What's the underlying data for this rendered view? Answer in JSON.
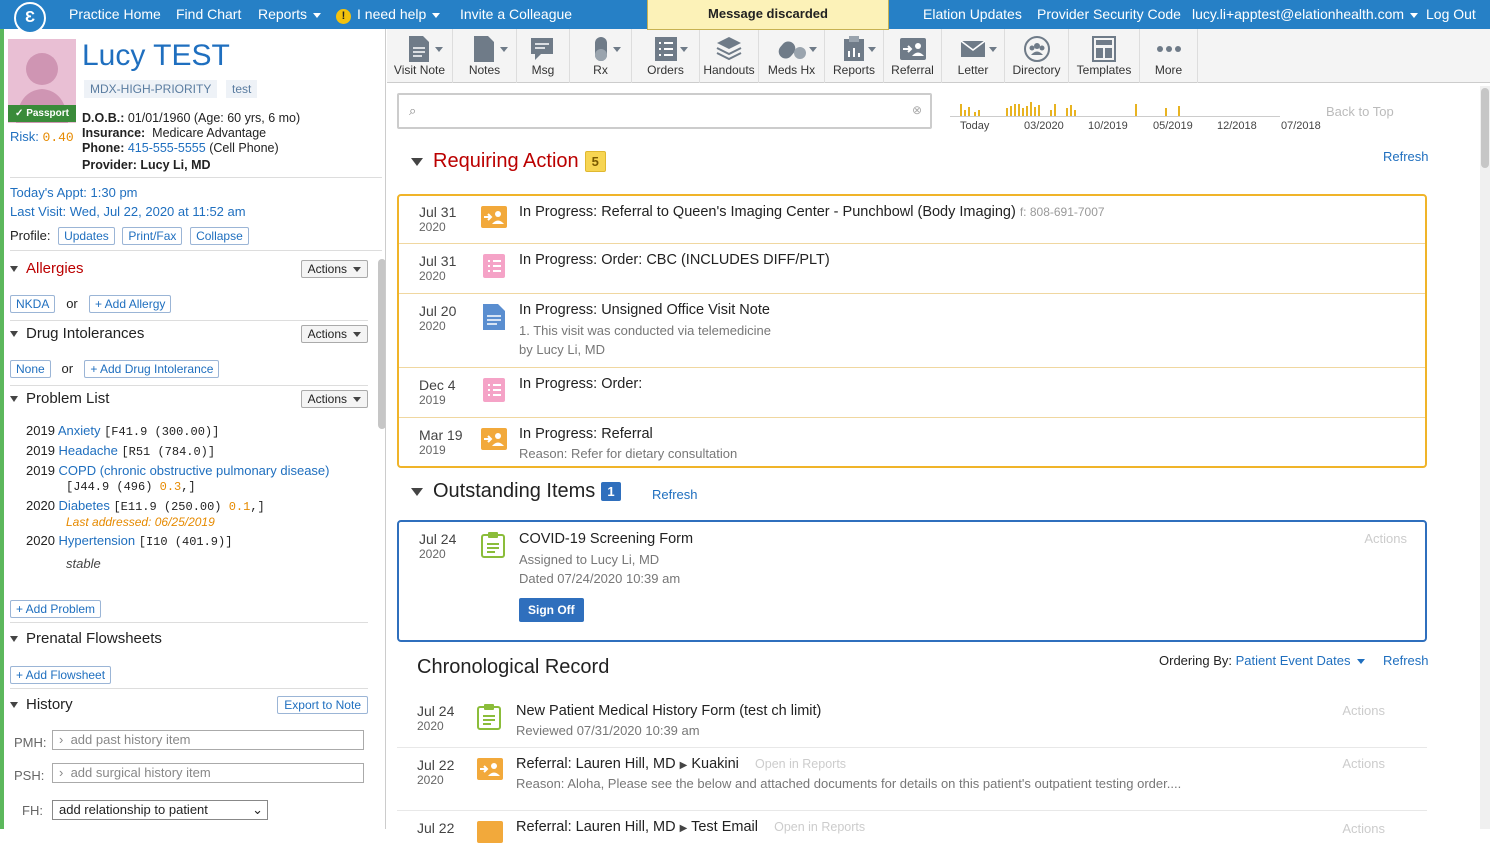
{
  "topnav": {
    "items": [
      "Practice Home",
      "Find Chart",
      "Reports",
      "I need help",
      "Invite a Colleague"
    ],
    "right_items": [
      "Elation Updates",
      "Provider Security Code",
      "lucy.li+apptest@elationhealth.com",
      "Log Out"
    ]
  },
  "toast": "Message discarded",
  "patient": {
    "name": "Lucy TEST",
    "tags": [
      "MDX-HIGH-PRIORITY",
      "test"
    ],
    "passport": "Passport",
    "risk_label": "Risk:",
    "risk_value": "0.40",
    "dob_label": "D.O.B.:",
    "dob": "01/01/1960 (Age: 60 yrs, 6 mo)",
    "insurance_label": "Insurance:",
    "insurance": "Medicare Advantage",
    "phone_label": "Phone:",
    "phone": "415-555-5555",
    "phone_type": "(Cell Phone)",
    "provider_label": "Provider:",
    "provider": "Lucy Li, MD",
    "todays_appt": "Today's Appt: 1:30 pm",
    "last_visit": "Last Visit: Wed, Jul 22, 2020 at 11:52 am",
    "profile_label": "Profile:",
    "profile_buttons": [
      "Updates",
      "Print/Fax",
      "Collapse"
    ]
  },
  "sections": {
    "allergies": {
      "title": "Allergies",
      "actions": "Actions",
      "nkda": "NKDA",
      "or": "or",
      "add": "+ Add Allergy"
    },
    "drug_intolerances": {
      "title": "Drug Intolerances",
      "actions": "Actions",
      "none": "None",
      "or": "or",
      "add": "+ Add Drug Intolerance"
    },
    "problem_list": {
      "title": "Problem List",
      "actions": "Actions",
      "problems": [
        {
          "year": "2019",
          "name": "Anxiety",
          "code": "[F41.9 (300.00)]"
        },
        {
          "year": "2019",
          "name": "Headache",
          "code": "[R51 (784.0)]"
        },
        {
          "year": "2019",
          "name": "COPD (chronic obstructive pulmonary disease)",
          "code": "[J44.9 (496)",
          "score": "0.3",
          "code_end": ",]"
        },
        {
          "year": "2020",
          "name": "Diabetes",
          "code": "[E11.9 (250.00)",
          "score": "0.1",
          "code_end": ",]",
          "note": "Last addressed: 06/25/2019"
        },
        {
          "year": "2020",
          "name": "Hypertension",
          "code": "[I10 (401.9)]",
          "status": "stable"
        }
      ],
      "add": "+ Add Problem"
    },
    "prenatal": {
      "title": "Prenatal Flowsheets",
      "add": "+ Add Flowsheet"
    },
    "history": {
      "title": "History",
      "export": "Export to Note",
      "pmh_label": "PMH:",
      "pmh_placeholder": "add past history item",
      "psh_label": "PSH:",
      "psh_placeholder": "add surgical history item",
      "fh_label": "FH:",
      "fh_value": "add relationship to patient"
    }
  },
  "toolbar": [
    "Visit Note",
    "Notes",
    "Msg",
    "Rx",
    "Orders",
    "Handouts",
    "Meds Hx",
    "Reports",
    "Referral",
    "Letter",
    "Directory",
    "Templates",
    "More"
  ],
  "timeline": {
    "labels": [
      "Today",
      "03/2020",
      "10/2019",
      "05/2019",
      "12/2018",
      "07/2018"
    ],
    "back_to_top": "Back to Top"
  },
  "requiring_action": {
    "title": "Requiring Action",
    "count": "5",
    "refresh": "Refresh",
    "rows": [
      {
        "date": "Jul 31",
        "year": "2020",
        "icon": "referral-icon",
        "title": "In Progress: Referral to Queen's Imaging Center - Punchbowl (Body Imaging)",
        "fax": "f: 808-691-7007"
      },
      {
        "date": "Jul 31",
        "year": "2020",
        "icon": "order-icon",
        "title": "In Progress: Order: CBC (INCLUDES DIFF/PLT)"
      },
      {
        "date": "Jul 20",
        "year": "2020",
        "icon": "note-icon",
        "title": "In Progress: Unsigned Office Visit Note",
        "sub1": "1. This visit was conducted via telemedicine",
        "sub2": "by Lucy Li, MD"
      },
      {
        "date": "Dec 4",
        "year": "2019",
        "icon": "order-icon",
        "title": "In Progress: Order:"
      },
      {
        "date": "Mar 19",
        "year": "2019",
        "icon": "referral-icon",
        "title": "In Progress: Referral",
        "sub1": "Reason: Refer for dietary consultation"
      }
    ]
  },
  "outstanding": {
    "title": "Outstanding Items",
    "count": "1",
    "refresh": "Refresh",
    "row": {
      "date": "Jul 24",
      "year": "2020",
      "title": "COVID-19 Screening Form",
      "sub1": "Assigned to Lucy Li, MD",
      "sub2": "Dated 07/24/2020 10:39 am",
      "button": "Sign Off",
      "actions": "Actions"
    }
  },
  "chronological": {
    "title": "Chronological Record",
    "ordering_label": "Ordering By:",
    "ordering_value": "Patient Event Dates",
    "refresh": "Refresh",
    "rows": [
      {
        "date": "Jul 24",
        "year": "2020",
        "title": "New Patient Medical History Form (test ch limit)",
        "sub1": "Reviewed 07/31/2020 10:39 am",
        "actions": "Actions"
      },
      {
        "date": "Jul 22",
        "year": "2020",
        "title": "Referral: Lauren Hill, MD",
        "to": "Kuakini",
        "open": "Open in Reports",
        "sub1": "Reason: Aloha, Please see the below and attached documents for details on this patient's outpatient testing order....",
        "actions": "Actions"
      },
      {
        "date": "Jul 22",
        "title": "Referral: Lauren Hill, MD",
        "to": "Test Email",
        "open": "Open in Reports",
        "actions": "Actions"
      }
    ]
  },
  "colors": {
    "brand": "#2680c6",
    "requiring": "#f0b429",
    "outstanding": "#2f6fbd",
    "alert_title": "#b00"
  }
}
